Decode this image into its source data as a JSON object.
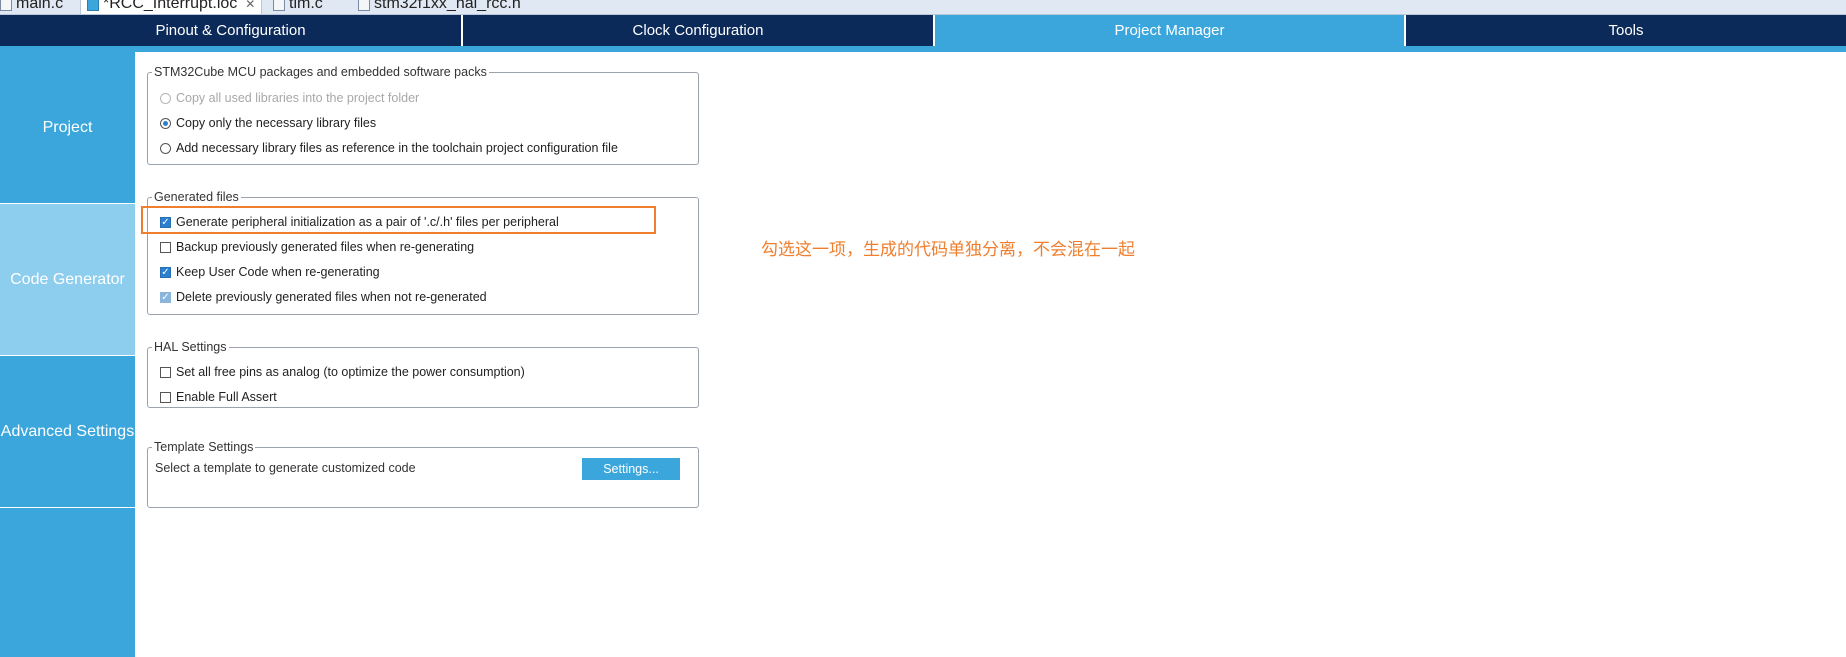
{
  "editor_tabs": [
    {
      "label": "main.c",
      "icon": "c-file-icon"
    },
    {
      "label": "*RCC_Interrupt.ioc",
      "icon": "ioc-file-icon",
      "active": true
    },
    {
      "label": "tim.c",
      "icon": "c-file-icon"
    },
    {
      "label": "stm32f1xx_hal_rcc.h",
      "icon": "h-file-icon"
    }
  ],
  "topnav": {
    "tabs": [
      "Pinout & Configuration",
      "Clock Configuration",
      "Project Manager",
      "Tools"
    ],
    "active_index": 2
  },
  "sidebar": {
    "items": [
      "Project",
      "Code Generator",
      "Advanced Settings"
    ],
    "active_index": 1
  },
  "groups": {
    "packages": {
      "legend": "STM32Cube MCU packages and embedded software packs",
      "options": [
        {
          "label": "Copy all used libraries into the project folder",
          "selected": false,
          "disabled": true
        },
        {
          "label": "Copy only the necessary library files",
          "selected": true,
          "disabled": false
        },
        {
          "label": "Add necessary library files as reference in the toolchain project configuration file",
          "selected": false,
          "disabled": false
        }
      ]
    },
    "generated": {
      "legend": "Generated files",
      "options": [
        {
          "label": "Generate peripheral initialization as a pair of '.c/.h' files per peripheral",
          "checked": true,
          "disabled": false
        },
        {
          "label": "Backup previously generated files when re-generating",
          "checked": false,
          "disabled": false
        },
        {
          "label": "Keep User Code when re-generating",
          "checked": true,
          "disabled": false
        },
        {
          "label": "Delete previously generated files when not re-generated",
          "checked": true,
          "disabled": true
        }
      ]
    },
    "hal": {
      "legend": "HAL Settings",
      "options": [
        {
          "label": "Set all free pins as analog (to optimize the power consumption)",
          "checked": false
        },
        {
          "label": "Enable Full Assert",
          "checked": false
        }
      ]
    },
    "template": {
      "legend": "Template Settings",
      "description": "Select a template to generate customized code",
      "button": "Settings..."
    }
  },
  "annotation": "勾选这一项，生成的代码单独分离，不会混在一起",
  "colors": {
    "nav_dark": "#0b2a5a",
    "accent": "#3aa6dc",
    "annotation": "#ef7f2f"
  }
}
